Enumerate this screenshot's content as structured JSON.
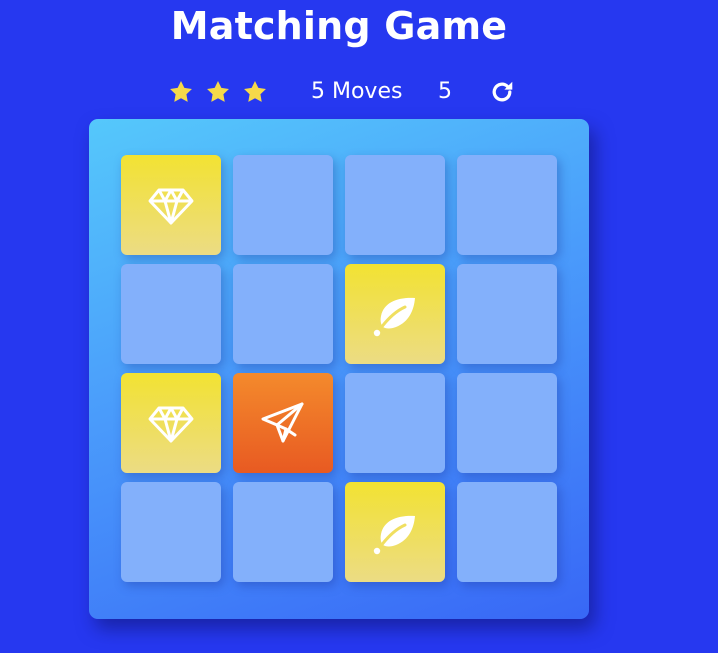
{
  "game": {
    "title": "Matching Game",
    "moves_label": "5 Moves",
    "timer": "5",
    "stars": [
      {
        "icon": "star-icon",
        "filled": true
      },
      {
        "icon": "star-icon",
        "filled": true
      },
      {
        "icon": "star-icon",
        "filled": true
      }
    ],
    "restart_icon": "restart-icon",
    "colors": {
      "background": "#2638f0",
      "card_hidden": "#83b0fb",
      "card_match": "#f2e232",
      "card_open": "#f48a2c",
      "star": "#f5d94a"
    }
  },
  "deck": {
    "cards": [
      {
        "state": "match",
        "icon": "diamond-icon"
      },
      {
        "state": "hidden",
        "icon": ""
      },
      {
        "state": "hidden",
        "icon": ""
      },
      {
        "state": "hidden",
        "icon": ""
      },
      {
        "state": "hidden",
        "icon": ""
      },
      {
        "state": "hidden",
        "icon": ""
      },
      {
        "state": "match",
        "icon": "leaf-icon"
      },
      {
        "state": "hidden",
        "icon": ""
      },
      {
        "state": "match",
        "icon": "diamond-icon"
      },
      {
        "state": "open",
        "icon": "paper-plane-icon"
      },
      {
        "state": "hidden",
        "icon": ""
      },
      {
        "state": "hidden",
        "icon": ""
      },
      {
        "state": "hidden",
        "icon": ""
      },
      {
        "state": "hidden",
        "icon": ""
      },
      {
        "state": "match",
        "icon": "leaf-icon"
      },
      {
        "state": "hidden",
        "icon": ""
      }
    ]
  }
}
